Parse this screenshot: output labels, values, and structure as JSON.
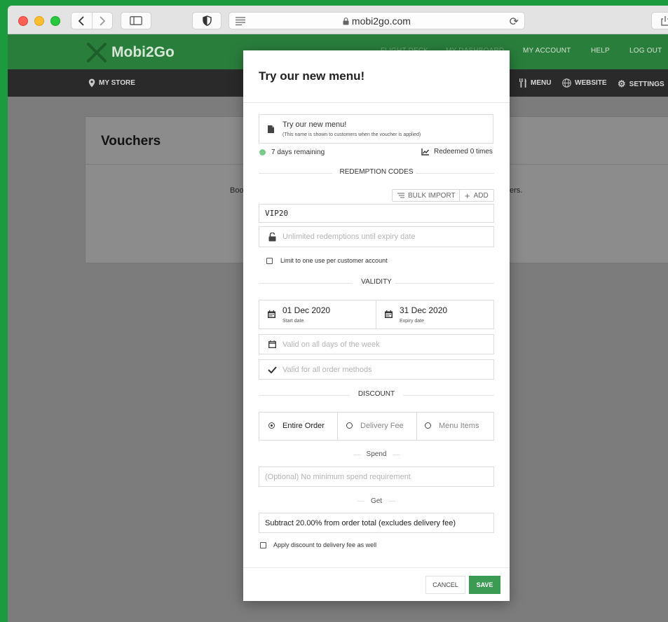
{
  "browser": {
    "url": "mobi2go.com"
  },
  "header": {
    "logo": "Mobi2Go",
    "nav": [
      "FLIGHT DECK",
      "MY DASHBOARD",
      "MY ACCOUNT",
      "HELP",
      "LOG OUT"
    ],
    "store": "MY STORE",
    "sub_nav": [
      "MENU",
      "WEBSITE",
      "SETTINGS"
    ]
  },
  "background": {
    "title": "Vouchers",
    "text_left": "Boo",
    "text_right": "ers."
  },
  "modal": {
    "title": "Try our new menu!",
    "name_value": "Try our new menu!",
    "name_hint": "(This name is shown to customers when the voucher is applied)",
    "days_remaining": "7 days remaining",
    "redeemed": "Redeemed 0 times",
    "sections": {
      "redemption": "REDEMPTION CODES",
      "validity": "VALIDITY",
      "discount": "DISCOUNT"
    },
    "bulk_import": "BULK IMPORT",
    "add": "ADD",
    "code": "VIP20",
    "redemptions_placeholder": "Unlimited redemptions until expiry date",
    "limit_label": "Limit to one use per customer account",
    "start_date": "01 Dec 2020",
    "start_label": "Start date",
    "expiry_date": "31 Dec 2020",
    "expiry_label": "Expiry date",
    "days_placeholder": "Valid on all days of the week",
    "methods_placeholder": "Valid for all order methods",
    "options": [
      "Entire Order",
      "Delivery Fee",
      "Menu Items"
    ],
    "selected_option": "Entire Order",
    "spend_label": "Spend",
    "spend_placeholder": "(Optional) No minimum spend requirement",
    "get_label": "Get",
    "get_value": "Subtract 20.00% from order total (excludes delivery fee)",
    "apply_delivery": "Apply discount to delivery fee as well",
    "cancel": "CANCEL",
    "save": "SAVE"
  },
  "colors": {
    "brand_green": "#2a7e3c",
    "save_green": "#3c9b52",
    "status_dot": "#7cc98e"
  }
}
